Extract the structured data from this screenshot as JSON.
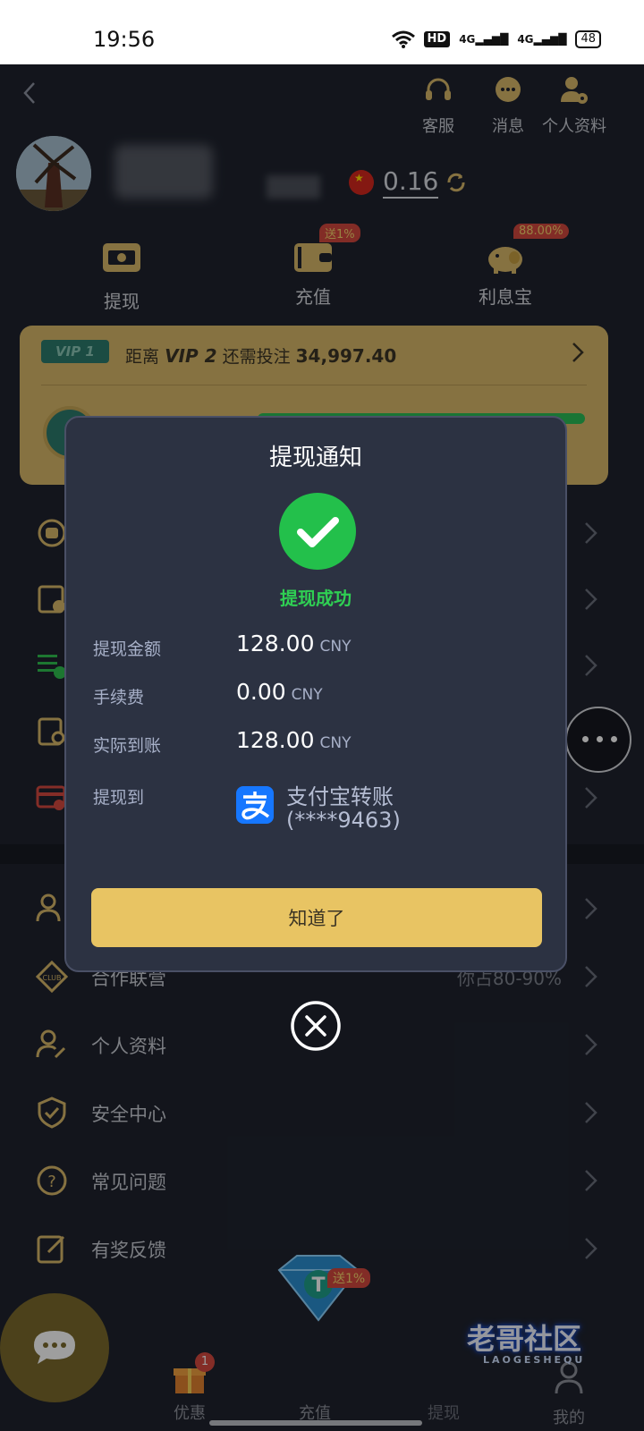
{
  "status_bar": {
    "time": "19:56",
    "hd": "HD",
    "net1": "4G",
    "net2": "4G",
    "battery": "48"
  },
  "topbar": {
    "actions": [
      {
        "label": "客服",
        "icon": "headset-icon"
      },
      {
        "label": "消息",
        "icon": "message-icon"
      },
      {
        "label": "个人资料",
        "icon": "user-settings-icon"
      }
    ]
  },
  "profile": {
    "balance": "0.16",
    "currency_flag": "china-flag-icon"
  },
  "quick_actions": [
    {
      "label": "提现",
      "icon": "withdraw-icon",
      "badge": ""
    },
    {
      "label": "充值",
      "icon": "wallet-icon",
      "badge": "送1%"
    },
    {
      "label": "利息宝",
      "icon": "piggy-bank-icon",
      "badge": "88.00%"
    }
  ],
  "vip": {
    "tag": "VIP 1",
    "prefix": "距离",
    "next_level": "VIP 2",
    "middle": "还需投注",
    "amount": "34,997.40"
  },
  "menu": {
    "section2": [
      {
        "label": "合作联营",
        "value": "你占80-90%",
        "icon": "club-icon"
      },
      {
        "label": "个人资料",
        "value": "",
        "icon": "user-edit-icon"
      },
      {
        "label": "安全中心",
        "value": "",
        "icon": "shield-icon"
      },
      {
        "label": "常见问题",
        "value": "",
        "icon": "question-icon"
      },
      {
        "label": "有奖反馈",
        "value": "",
        "icon": "feedback-edit-icon"
      }
    ]
  },
  "tabbar": {
    "tabs": [
      {
        "label": "优惠",
        "icon": "gift-icon",
        "badge": "1"
      },
      {
        "label": "充值",
        "icon": "diamond-icon",
        "badge": "送1%"
      },
      {
        "label": "提现",
        "icon": "withdraw-tab-icon",
        "badge": ""
      },
      {
        "label": "我的",
        "icon": "profile-tab-icon",
        "badge": ""
      }
    ]
  },
  "watermark": {
    "title": "老哥社区",
    "subtitle": "LAOGESHEQU"
  },
  "modal": {
    "title": "提现通知",
    "status": "提现成功",
    "rows": [
      {
        "label": "提现金额",
        "value": "128.00",
        "unit": "CNY"
      },
      {
        "label": "手续费",
        "value": "0.00",
        "unit": "CNY"
      },
      {
        "label": "实际到账",
        "value": "128.00",
        "unit": "CNY"
      }
    ],
    "destination_label": "提现到",
    "destination_name": "支付宝转账",
    "destination_account": "(****9463)",
    "confirm_button": "知道了"
  },
  "colors": {
    "accent_gold": "#e8c463",
    "success_green": "#23c04b",
    "background": "#1f232e",
    "modal_bg": "#2c3242"
  }
}
